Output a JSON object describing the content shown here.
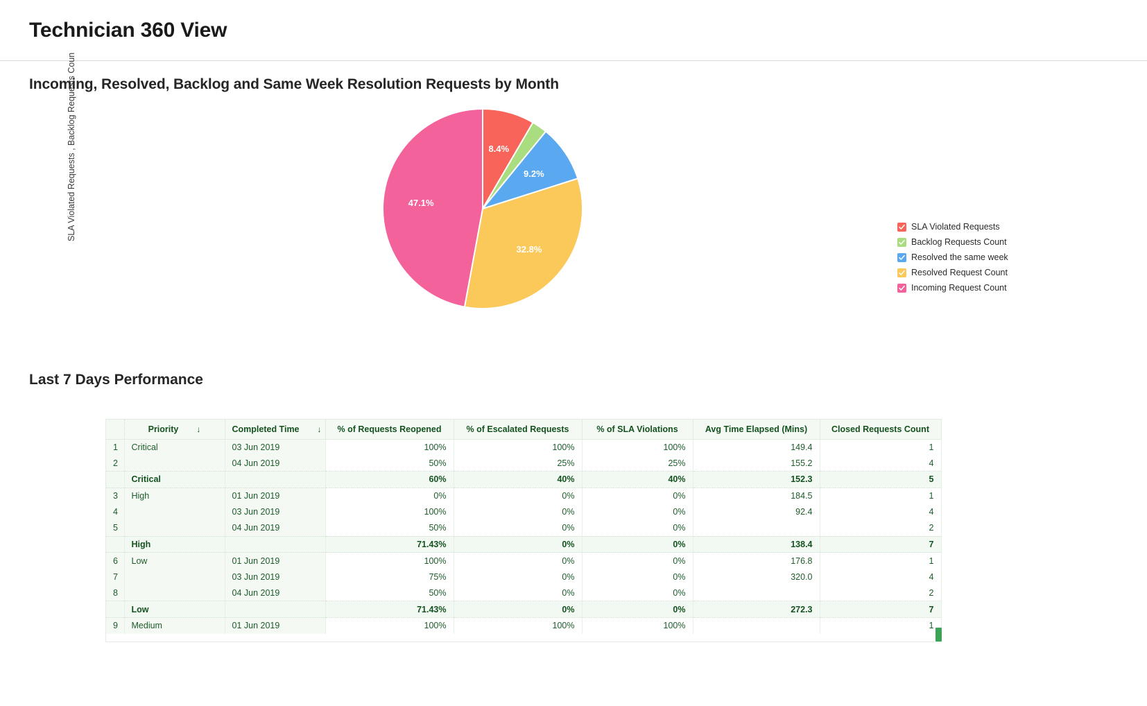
{
  "header": {
    "title": "Technician 360 View"
  },
  "chart_section": {
    "title": "Incoming, Resolved, Backlog and Same Week Resolution Requests by Month",
    "y_axis_label": "SLA Violated Requests , Backlog Requests Coun"
  },
  "legend": {
    "items": [
      {
        "label": "SLA Violated Requests",
        "color": "#f8635a",
        "icon": "checkbox-checked-icon"
      },
      {
        "label": "Backlog Requests Count",
        "color": "#a9dd7f",
        "icon": "checkbox-checked-icon"
      },
      {
        "label": "Resolved the same week",
        "color": "#5aa9f0",
        "icon": "checkbox-checked-icon"
      },
      {
        "label": "Resolved Request Count",
        "color": "#fbc85a",
        "icon": "checkbox-checked-icon"
      },
      {
        "label": "Incoming Request Count",
        "color": "#f3629a",
        "icon": "checkbox-checked-icon"
      }
    ]
  },
  "chart_data": {
    "type": "pie",
    "title": "Incoming, Resolved, Backlog and Same Week Resolution Requests by Month",
    "ylabel": "SLA Violated Requests , Backlog Requests Coun",
    "legend_position": "right",
    "labels": [
      "SLA Violated Requests",
      "Backlog Requests Count",
      "Resolved the same week",
      "Resolved Request Count",
      "Incoming Request Count"
    ],
    "values": [
      8.4,
      2.5,
      9.2,
      32.8,
      47.1
    ],
    "value_labels": [
      "8.4%",
      "",
      "9.2%",
      "32.8%",
      "47.1%"
    ],
    "colors": [
      "#f8635a",
      "#a9dd7f",
      "#5aa9f0",
      "#fbc85a",
      "#f3629a"
    ]
  },
  "table_section": {
    "title": "Last 7 Days Performance",
    "columns": [
      {
        "label": "",
        "sort": ""
      },
      {
        "label": "Priority",
        "sort": "↓"
      },
      {
        "label": "Completed Time",
        "sort": "↓"
      },
      {
        "label": "% of Requests Reopened",
        "sort": ""
      },
      {
        "label": "% of Escalated Requests",
        "sort": ""
      },
      {
        "label": "% of SLA Violations",
        "sort": ""
      },
      {
        "label": "Avg Time Elapsed (Mins)",
        "sort": ""
      },
      {
        "label": "Closed Requests Count",
        "sort": ""
      }
    ],
    "rows": [
      {
        "type": "data",
        "idx": "1",
        "priority": "Critical",
        "completed": "03 Jun 2019",
        "reopened": "100%",
        "escalated": "100%",
        "sla": "100%",
        "avg": "149.4",
        "closed": "1"
      },
      {
        "type": "data",
        "idx": "2",
        "priority": "",
        "completed": "04 Jun 2019",
        "reopened": "50%",
        "escalated": "25%",
        "sla": "25%",
        "avg": "155.2",
        "closed": "4"
      },
      {
        "type": "subtotal",
        "idx": "",
        "priority": "Critical",
        "completed": "",
        "reopened": "60%",
        "escalated": "40%",
        "sla": "40%",
        "avg": "152.3",
        "closed": "5"
      },
      {
        "type": "data",
        "idx": "3",
        "priority": "High",
        "completed": "01 Jun 2019",
        "reopened": "0%",
        "escalated": "0%",
        "sla": "0%",
        "avg": "184.5",
        "closed": "1"
      },
      {
        "type": "data",
        "idx": "4",
        "priority": "",
        "completed": "03 Jun 2019",
        "reopened": "100%",
        "escalated": "0%",
        "sla": "0%",
        "avg": "92.4",
        "closed": "4"
      },
      {
        "type": "data",
        "idx": "5",
        "priority": "",
        "completed": "04 Jun 2019",
        "reopened": "50%",
        "escalated": "0%",
        "sla": "0%",
        "avg": "",
        "closed": "2"
      },
      {
        "type": "subtotal",
        "idx": "",
        "priority": "High",
        "completed": "",
        "reopened": "71.43%",
        "escalated": "0%",
        "sla": "0%",
        "avg": "138.4",
        "closed": "7"
      },
      {
        "type": "data",
        "idx": "6",
        "priority": "Low",
        "completed": "01 Jun 2019",
        "reopened": "100%",
        "escalated": "0%",
        "sla": "0%",
        "avg": "176.8",
        "closed": "1"
      },
      {
        "type": "data",
        "idx": "7",
        "priority": "",
        "completed": "03 Jun 2019",
        "reopened": "75%",
        "escalated": "0%",
        "sla": "0%",
        "avg": "320.0",
        "closed": "4"
      },
      {
        "type": "data",
        "idx": "8",
        "priority": "",
        "completed": "04 Jun 2019",
        "reopened": "50%",
        "escalated": "0%",
        "sla": "0%",
        "avg": "",
        "closed": "2"
      },
      {
        "type": "subtotal",
        "idx": "",
        "priority": "Low",
        "completed": "",
        "reopened": "71.43%",
        "escalated": "0%",
        "sla": "0%",
        "avg": "272.3",
        "closed": "7"
      },
      {
        "type": "data",
        "idx": "9",
        "priority": "Medium",
        "completed": "01 Jun 2019",
        "reopened": "100%",
        "escalated": "100%",
        "sla": "100%",
        "avg": "",
        "closed": "1"
      }
    ]
  }
}
